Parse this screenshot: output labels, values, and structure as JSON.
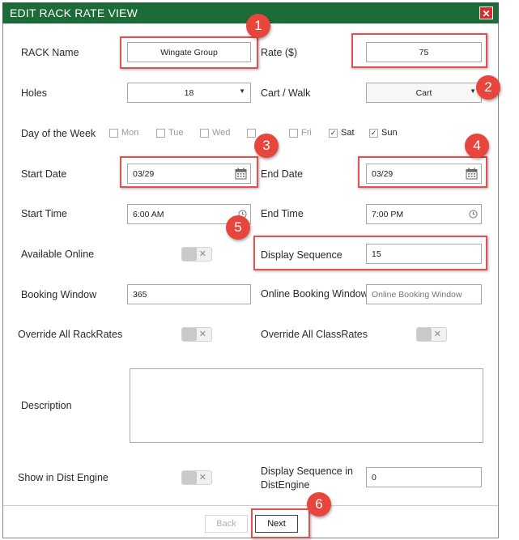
{
  "dialog": {
    "title": "EDIT RACK RATE VIEW",
    "close_glyph": "✕"
  },
  "labels": {
    "rack_name": "RACK Name",
    "rate": "Rate ($)",
    "holes": "Holes",
    "cart_walk": "Cart / Walk",
    "day_of_week": "Day of the Week",
    "start_date": "Start Date",
    "end_date": "End Date",
    "start_time": "Start Time",
    "end_time": "End Time",
    "available_online": "Available Online",
    "display_sequence": "Display Sequence",
    "booking_window": "Booking Window",
    "online_booking_window": "Online Booking Window",
    "override_rack": "Override All RackRates",
    "override_class": "Override All ClassRates",
    "description": "Description",
    "show_dist": "Show in Dist Engine",
    "display_seq_dist": "Display Sequence in DistEngine"
  },
  "values": {
    "rack_name": "Wingate Group",
    "rate": "75",
    "holes": "18",
    "cart_walk": "Cart",
    "start_date": "03/29",
    "end_date": "03/29",
    "start_time": "6:00 AM",
    "end_time": "7:00 PM",
    "display_sequence": "15",
    "booking_window": "365",
    "online_booking_window_placeholder": "Online Booking Window",
    "display_seq_dist": "0",
    "description": ""
  },
  "days": [
    {
      "label": "Mon",
      "checked": false
    },
    {
      "label": "Tue",
      "checked": false
    },
    {
      "label": "Wed",
      "checked": false
    },
    {
      "label": "",
      "checked": false
    },
    {
      "label": "Fri",
      "checked": false
    },
    {
      "label": "Sat",
      "checked": true
    },
    {
      "label": "Sun",
      "checked": true
    }
  ],
  "toggles": {
    "available_online": false,
    "override_rack": false,
    "override_class": false,
    "show_dist": false
  },
  "footer": {
    "back_label": "Back",
    "next_label": "Next"
  },
  "annotations": [
    "1",
    "2",
    "3",
    "4",
    "5",
    "6"
  ],
  "colors": {
    "title_bar": "#1d6b36",
    "close_button": "#d92c2c",
    "highlight_border": "#e05252",
    "badge": "#e8453c"
  },
  "icons": {
    "close": "close-icon",
    "dropdown": "caret-down-icon",
    "date": "calendar-icon",
    "time": "clock-icon",
    "check": "checkmark-icon",
    "toggle_off": "x-icon"
  }
}
